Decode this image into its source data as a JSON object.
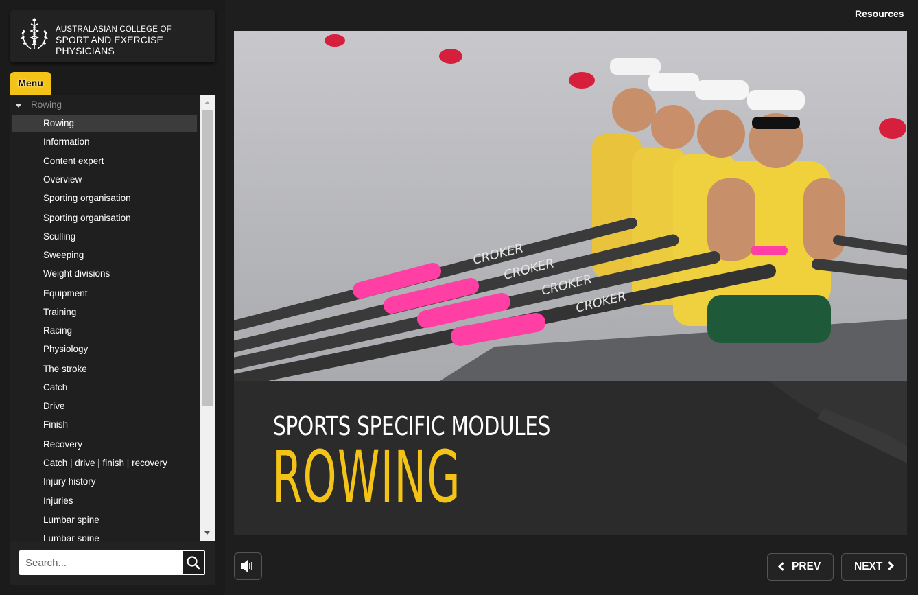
{
  "header": {
    "org_line1": "AUSTRALASIAN COLLEGE OF",
    "org_line2": "SPORT AND EXERCISE PHYSICIANS",
    "resources_label": "Resources"
  },
  "sidebar": {
    "menu_tab_label": "Menu",
    "group_label": "Rowing",
    "items": [
      {
        "label": "Rowing",
        "active": true
      },
      {
        "label": "Information"
      },
      {
        "label": "Content expert"
      },
      {
        "label": "Overview"
      },
      {
        "label": "Sporting organisation"
      },
      {
        "label": "Sporting organisation"
      },
      {
        "label": "Sculling"
      },
      {
        "label": "Sweeping"
      },
      {
        "label": "Weight divisions"
      },
      {
        "label": "Equipment"
      },
      {
        "label": "Training"
      },
      {
        "label": "Racing"
      },
      {
        "label": "Physiology"
      },
      {
        "label": "The stroke"
      },
      {
        "label": "Catch"
      },
      {
        "label": "Drive"
      },
      {
        "label": "Finish"
      },
      {
        "label": "Recovery"
      },
      {
        "label": "Catch | drive | finish | recovery"
      },
      {
        "label": "Injury history"
      },
      {
        "label": "Injuries"
      },
      {
        "label": "Lumbar spine"
      },
      {
        "label": "Lumbar spine"
      }
    ],
    "search": {
      "placeholder": "Search...",
      "value": ""
    }
  },
  "slide": {
    "subtitle": "SPORTS SPECIFIC MODULES",
    "title": "ROWING",
    "oar_brand": "CROKER"
  },
  "controls": {
    "prev_label": "PREV",
    "next_label": "NEXT",
    "audio_icon": "speaker-icon"
  },
  "colors": {
    "accent": "#f4c317",
    "background": "#1e1e1e",
    "oar_grip": "#ff3fa4"
  }
}
